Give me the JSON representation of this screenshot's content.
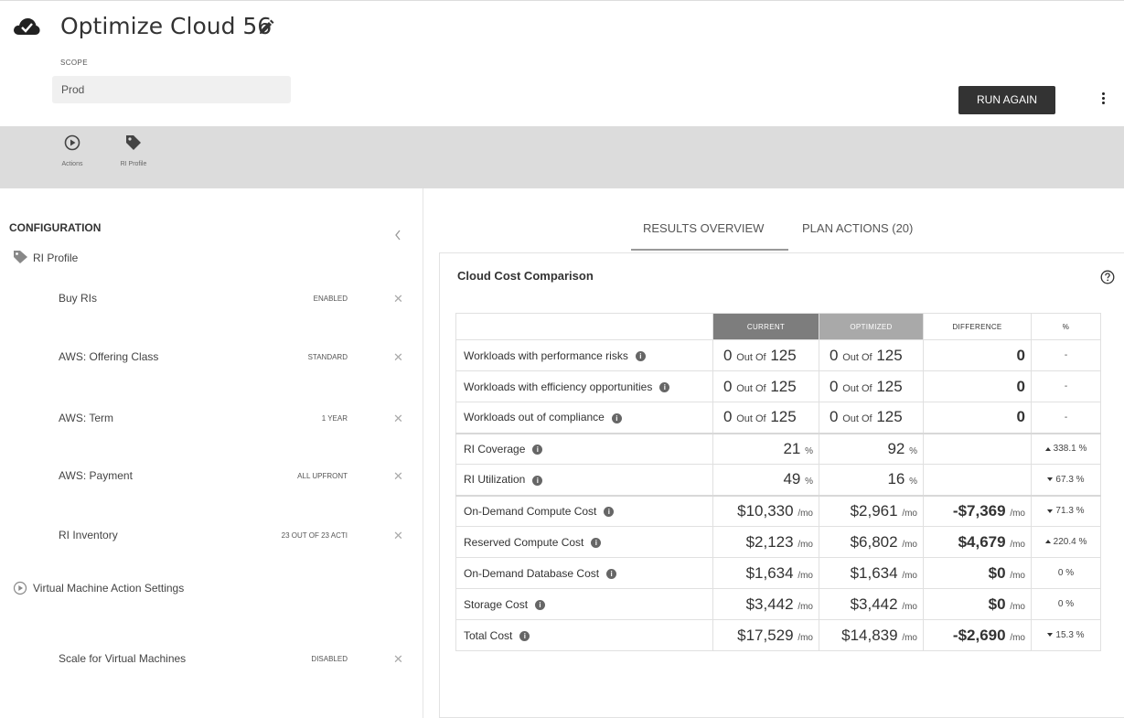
{
  "header": {
    "title": "Optimize Cloud 56",
    "scope_label": "SCOPE",
    "scope_value": "Prod",
    "run_again": "RUN AGAIN"
  },
  "toolbar": {
    "actions": "Actions",
    "ri_profile": "RI Profile"
  },
  "config": {
    "title": "CONFIGURATION",
    "ri_section": "RI Profile",
    "vm_section": "Virtual Machine Action Settings",
    "rows": [
      {
        "name": "Buy RIs",
        "value": "ENABLED"
      },
      {
        "name": "AWS: Offering Class",
        "value": "STANDARD"
      },
      {
        "name": "AWS: Term",
        "value": "1 YEAR"
      },
      {
        "name": "AWS: Payment",
        "value": "ALL UPFRONT"
      },
      {
        "name": "RI Inventory",
        "value": "23 OUT OF 23 ACTI"
      },
      {
        "name": "Scale for Virtual Machines",
        "value": "DISABLED"
      }
    ]
  },
  "tabs": {
    "results": "RESULTS OVERVIEW",
    "actions": "PLAN ACTIONS (20)"
  },
  "card": {
    "title": "Cloud Cost Comparison",
    "columns": {
      "current": "CURRENT",
      "optimized": "OPTIMIZED",
      "difference": "DIFFERENCE",
      "pct": "%"
    },
    "out_of": "Out Of",
    "unit_pct": "%",
    "unit_mo": "/mo",
    "rows": [
      {
        "label": "Workloads with performance risks",
        "cur": "0",
        "cur_total": "125",
        "opt": "0",
        "opt_total": "125",
        "diff": "0",
        "pct": "-"
      },
      {
        "label": "Workloads with efficiency opportunities",
        "cur": "0",
        "cur_total": "125",
        "opt": "0",
        "opt_total": "125",
        "diff": "0",
        "pct": "-"
      },
      {
        "label": "Workloads out of compliance",
        "cur": "0",
        "cur_total": "125",
        "opt": "0",
        "opt_total": "125",
        "diff": "0",
        "pct": "-"
      },
      {
        "label": "RI Coverage",
        "cur": "21",
        "opt": "92",
        "diff": "",
        "pct": "338.1 %"
      },
      {
        "label": "RI Utilization",
        "cur": "49",
        "opt": "16",
        "diff": "",
        "pct": "67.3 %"
      },
      {
        "label": "On-Demand Compute Cost",
        "cur": "$10,330",
        "opt": "$2,961",
        "diff": "-$7,369",
        "pct": "71.3 %"
      },
      {
        "label": "Reserved Compute Cost",
        "cur": "$2,123",
        "opt": "$6,802",
        "diff": "$4,679",
        "pct": "220.4 %"
      },
      {
        "label": "On-Demand Database Cost",
        "cur": "$1,634",
        "opt": "$1,634",
        "diff": "$0",
        "pct": "0 %"
      },
      {
        "label": "Storage Cost",
        "cur": "$3,442",
        "opt": "$3,442",
        "diff": "$0",
        "pct": "0 %"
      },
      {
        "label": "Total Cost",
        "cur": "$17,529",
        "opt": "$14,839",
        "diff": "-$2,690",
        "pct": "15.3 %"
      }
    ]
  }
}
